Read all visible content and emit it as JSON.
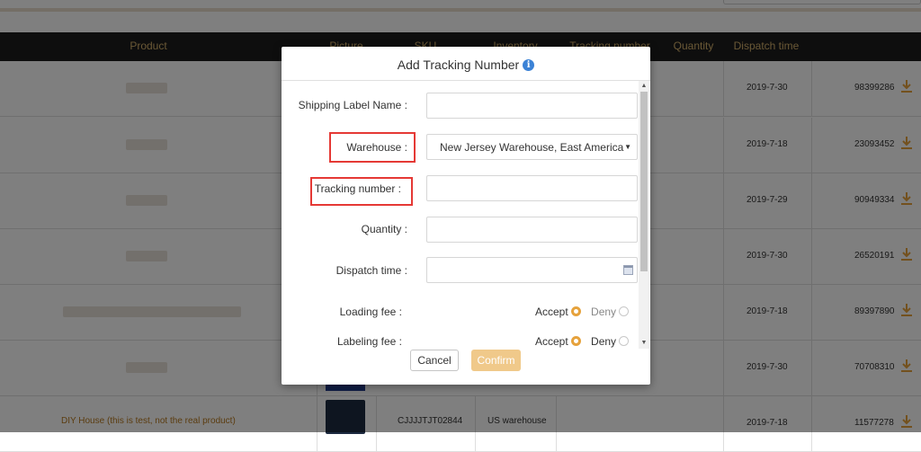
{
  "table": {
    "headers": [
      "Product",
      "Picture",
      "SKU",
      "Inventory",
      "Tracking number",
      "Quantity",
      "Dispatch time"
    ],
    "rows": [
      {
        "date": "2019-7-30",
        "id": "98399286"
      },
      {
        "date": "2019-7-18",
        "id": "23093452"
      },
      {
        "date": "2019-7-29",
        "id": "90949334"
      },
      {
        "date": "2019-7-30",
        "id": "26520191"
      },
      {
        "date": "2019-7-18",
        "id": "89397890"
      },
      {
        "date": "2019-7-30",
        "id": "70708310"
      },
      {
        "product": "DIY House (this is test, not the real product)",
        "sku": "CJJJJTJT02844",
        "inventory": "US warehouse",
        "date": "2019-7-18",
        "id": "11577278"
      }
    ]
  },
  "modal": {
    "title": "Add Tracking Number",
    "info_icon": "i",
    "fields": {
      "shipping_label": {
        "label": "Shipping Label Name :",
        "value": ""
      },
      "warehouse": {
        "label": "Warehouse :",
        "value": "New Jersey Warehouse, East America"
      },
      "tracking": {
        "label": "Tracking number :",
        "value": ""
      },
      "quantity": {
        "label": "Quantity :",
        "value": ""
      },
      "dispatch": {
        "label": "Dispatch time :",
        "value": ""
      },
      "loading_fee": {
        "label": "Loading fee :",
        "accept": "Accept",
        "deny": "Deny",
        "selected": "Accept"
      },
      "labeling_fee": {
        "label": "Labeling fee :",
        "accept": "Accept",
        "deny": "Deny",
        "selected": "Accept"
      }
    },
    "buttons": {
      "cancel": "Cancel",
      "confirm": "Confirm"
    }
  },
  "colors": {
    "accent": "#e6a23c",
    "header_text": "#d4b06c",
    "highlight": "#e53935",
    "info": "#3b82d6"
  },
  "icons": [
    "download-icon",
    "info-icon",
    "calendar-icon",
    "radio-icon",
    "scroll-up-icon",
    "scroll-down-icon",
    "dropdown-caret-icon"
  ]
}
